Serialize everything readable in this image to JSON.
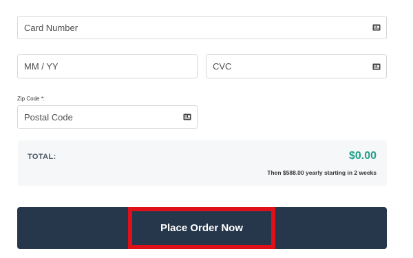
{
  "payment": {
    "card_number": {
      "placeholder": "Card Number",
      "value": "",
      "icon": "card-icon"
    },
    "expiry": {
      "placeholder": "MM / YY",
      "value": ""
    },
    "cvc": {
      "placeholder": "CVC",
      "value": "",
      "icon": "card-icon"
    },
    "zip": {
      "label": "Zip Code *:",
      "placeholder": "Postal Code",
      "value": "",
      "icon": "card-icon"
    }
  },
  "total": {
    "label": "TOTAL:",
    "amount": "$0.00",
    "note": "Then $588.00 yearly starting in 2 weeks"
  },
  "order_button": {
    "label": "Place Order Now"
  },
  "colors": {
    "accent_green": "#1f9e88",
    "button_background": "#26374b",
    "highlight_border": "#e0101a",
    "panel_background": "#f5f7f8"
  }
}
